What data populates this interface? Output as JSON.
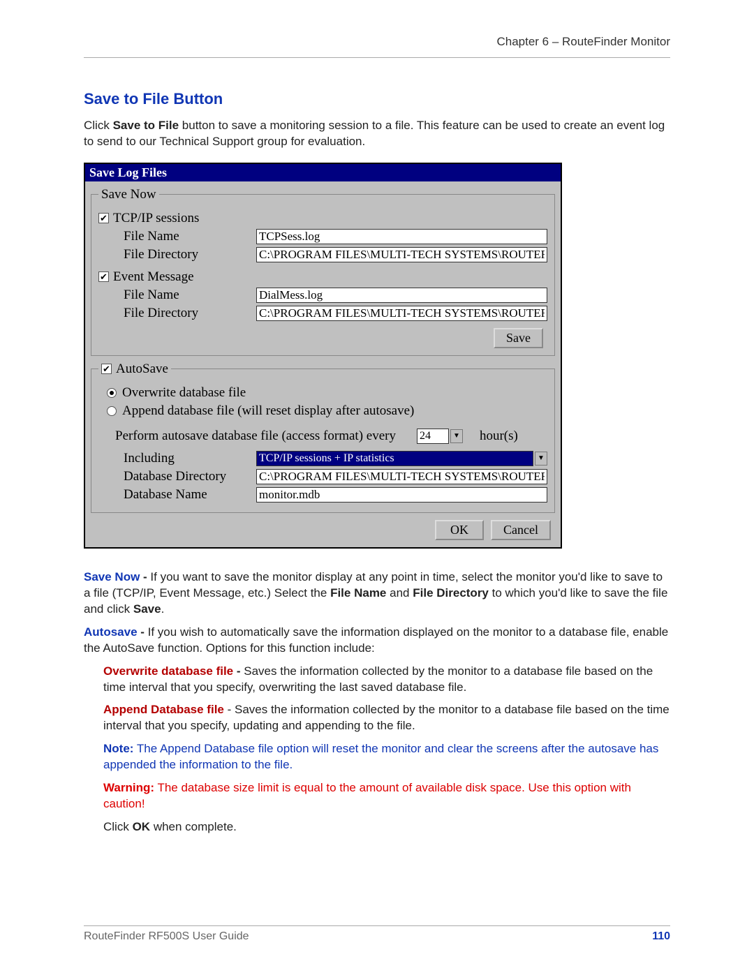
{
  "header": {
    "chapter": "Chapter 6 – RouteFinder Monitor"
  },
  "section": {
    "title": "Save to File Button",
    "intro": {
      "a": "Click",
      "b": "Save to File",
      "c": "button to save a monitoring session to a file. This feature can be used to create an event log to send to our Technical Support group for evaluation."
    }
  },
  "dialog": {
    "title": "Save Log Files",
    "labels": {
      "fileName": "File Name",
      "fileDirectory": "File Directory",
      "including": "Including",
      "dbDirectory": "Database Directory",
      "dbName": "Database Name"
    },
    "saveNow": {
      "legend": "Save Now",
      "tcpip": {
        "label": "TCP/IP sessions",
        "fileName": "TCPSess.log",
        "fileDir": "C:\\PROGRAM FILES\\MULTI-TECH SYSTEMS\\ROUTEFINDER M"
      },
      "event": {
        "label": "Event Message",
        "fileName": "DialMess.log",
        "fileDir": "C:\\PROGRAM FILES\\MULTI-TECH SYSTEMS\\ROUTEFINDER M"
      }
    },
    "autoSave": {
      "legend": "AutoSave",
      "overwrite": "Overwrite database file",
      "append": "Append database file (will reset display after autosave)",
      "performLabel": "Perform autosave database file (access format) every",
      "hoursValue": "24",
      "hoursUnit": "hour(s)",
      "includingValue": "TCP/IP sessions + IP statistics",
      "dbDir": "C:\\PROGRAM FILES\\MULTI-TECH SYSTEMS\\ROUTEFINDER M",
      "dbName": "monitor.mdb"
    },
    "buttons": {
      "save": "Save",
      "ok": "OK",
      "cancel": "Cancel"
    }
  },
  "desc": {
    "saveNow": {
      "head": "Save Now",
      "t1": "If you want to save the monitor display at any point in time, select the monitor you'd like to save to a file (TCP/IP, Event Message, etc.)  Select the",
      "b1": "File Name",
      "t2": "and",
      "b2": "File Directory",
      "t3": "to which you'd like to save the file and click",
      "b3": "Save",
      "t4": "."
    },
    "autosave": {
      "head": "Autosave",
      "text": "If you wish to automatically save the information displayed on the monitor to a database file, enable the AutoSave function. Options for this function include:"
    },
    "overwrite": {
      "head": "Overwrite database file",
      "text": "Saves the information collected by the monitor to a database file based on the time interval that you specify, overwriting the last saved database file."
    },
    "append": {
      "head": "Append Database file",
      "text": "Saves the information collected by the monitor to a database file based on the time interval that you specify, updating and appending to the file."
    },
    "note": {
      "head": "Note:",
      "text": "The Append Database file option will reset the  monitor and clear the screens after the autosave has appended the information to the file."
    },
    "warning": {
      "head": "Warning:",
      "text": "The database size limit is equal to the amount of available disk space.  Use this option with caution!"
    },
    "closing": {
      "a": "Click",
      "b": "OK",
      "c": "when complete."
    }
  },
  "footer": {
    "doc": "RouteFinder RF500S User Guide",
    "page": "110"
  }
}
